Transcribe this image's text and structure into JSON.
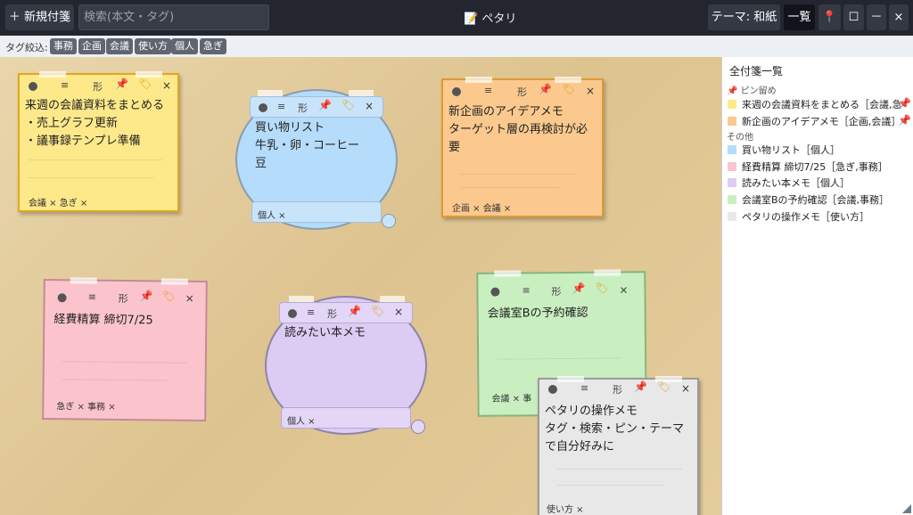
{
  "toolbar": {
    "new_note_label": "＋ 新規付箋",
    "search_placeholder": "検索(本文・タグ)",
    "app_title": "ペタリ",
    "theme_label": "テーマ: 和紙",
    "list_label": "一覧",
    "pin_icon": "pin-icon",
    "max_label": "☐",
    "min_label": "－",
    "close_label": "×"
  },
  "tag_filter": {
    "label": "タグ絞込:",
    "tags": [
      "事務",
      "企画",
      "会議",
      "使い方",
      "個人",
      "急ぎ"
    ]
  },
  "notes": [
    {
      "text": "来週の会議資料をまとめる\n・売上グラフ更新\n・議事録テンプレ準備",
      "tags": "会議 ×  急ぎ ×",
      "color": "#fde989",
      "pinned": true
    },
    {
      "text": "買い物リスト\n牛乳・卵・コーヒー\n豆",
      "tags": "個人 ×",
      "color": "#b5dcfa",
      "pinned": false
    },
    {
      "text": "新企画のアイデアメモ\nターゲット層の再検討が必\n要",
      "tags": "企画 ×  会議 ×",
      "color": "#fbc98e",
      "pinned": true
    },
    {
      "text": "経費精算 締切7/25",
      "tags": "急ぎ ×  事務 ×",
      "color": "#fbc4cc",
      "pinned": false
    },
    {
      "text": "読みたい本メモ",
      "tags": "個人 ×",
      "color": "#dccbf3",
      "pinned": false
    },
    {
      "text": "会議室Bの予約確認",
      "tags": "会議 ×  事",
      "color": "#c9efc0",
      "pinned": false
    },
    {
      "text": "ペタリの操作メモ\nタグ・検索・ピン・テーマ\nで自分好みに",
      "tags": "使い方 ×",
      "color": "#e8e8e8",
      "pinned": false
    }
  ],
  "note_header": {
    "handle": "≡",
    "shape": "形",
    "close": "×"
  },
  "panel": {
    "title": "全付箋一覧",
    "pinned_label": "ピン留め",
    "other_label": "その他",
    "pinned_items": [
      {
        "label": "来週の会議資料をまとめる［会議,急",
        "color": "#fde989"
      },
      {
        "label": "新企画のアイデアメモ［企画,会議］",
        "color": "#fbc98e"
      }
    ],
    "other_items": [
      {
        "label": "買い物リスト［個人］",
        "color": "#b5dcfa"
      },
      {
        "label": "経費精算 締切7/25［急ぎ,事務］",
        "color": "#fbc4cc"
      },
      {
        "label": "読みたい本メモ［個人］",
        "color": "#dccbf3"
      },
      {
        "label": "会議室Bの予約確認［会議,事務］",
        "color": "#c9efc0"
      },
      {
        "label": "ペタリの操作メモ［使い方］",
        "color": "#e8e8e8"
      }
    ]
  }
}
